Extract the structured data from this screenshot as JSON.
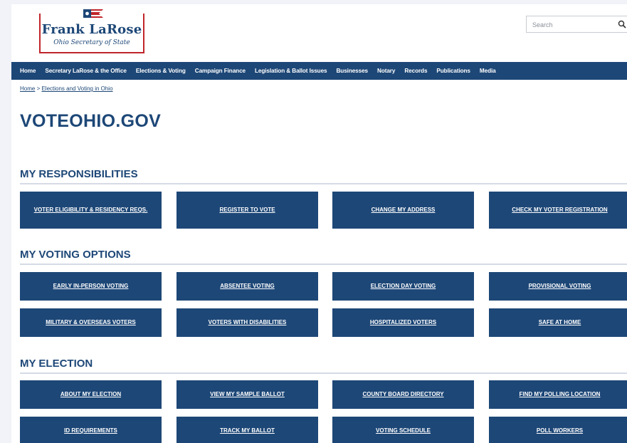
{
  "header": {
    "logo_name": "Frank LaRose",
    "logo_subtitle": "Ohio Secretary of State",
    "search_placeholder": "Search"
  },
  "nav": {
    "items": [
      "Home",
      "Secretary LaRose & the Office",
      "Elections & Voting",
      "Campaign Finance",
      "Legislation & Ballot Issues",
      "Businesses",
      "Notary",
      "Records",
      "Publications",
      "Media"
    ]
  },
  "breadcrumb": {
    "home": "Home",
    "separator": " > ",
    "current": "Elections and Voting in Ohio"
  },
  "page_title": "VOTEOHIO.GOV",
  "sections": [
    {
      "title": "MY RESPONSIBILITIES",
      "buttons": [
        "VOTER ELIGIBILITY & RESIDENCY REQS.",
        "REGISTER TO VOTE",
        "CHANGE MY ADDRESS",
        "CHECK MY VOTER REGISTRATION"
      ]
    },
    {
      "title": "MY VOTING OPTIONS",
      "buttons": [
        "EARLY IN-PERSON VOTING",
        "ABSENTEE VOTING",
        "ELECTION DAY VOTING",
        "PROVISIONAL VOTING",
        "MILITARY & OVERSEAS VOTERS",
        "VOTERS WITH DISABILITIES",
        "HOSPITALIZED VOTERS",
        "SAFE AT HOME"
      ]
    },
    {
      "title": "MY ELECTION",
      "buttons": [
        "ABOUT MY ELECTION",
        "VIEW MY SAMPLE BALLOT",
        "COUNTY BOARD DIRECTORY",
        "FIND MY POLLING LOCATION",
        "ID REQUIREMENTS",
        "TRACK MY BALLOT",
        "VOTING SCHEDULE",
        "POLL WORKERS"
      ]
    }
  ],
  "colors": {
    "brand_navy": "#1d4777",
    "logo_red": "#c0252b",
    "page_background": "#f1f3f8"
  }
}
